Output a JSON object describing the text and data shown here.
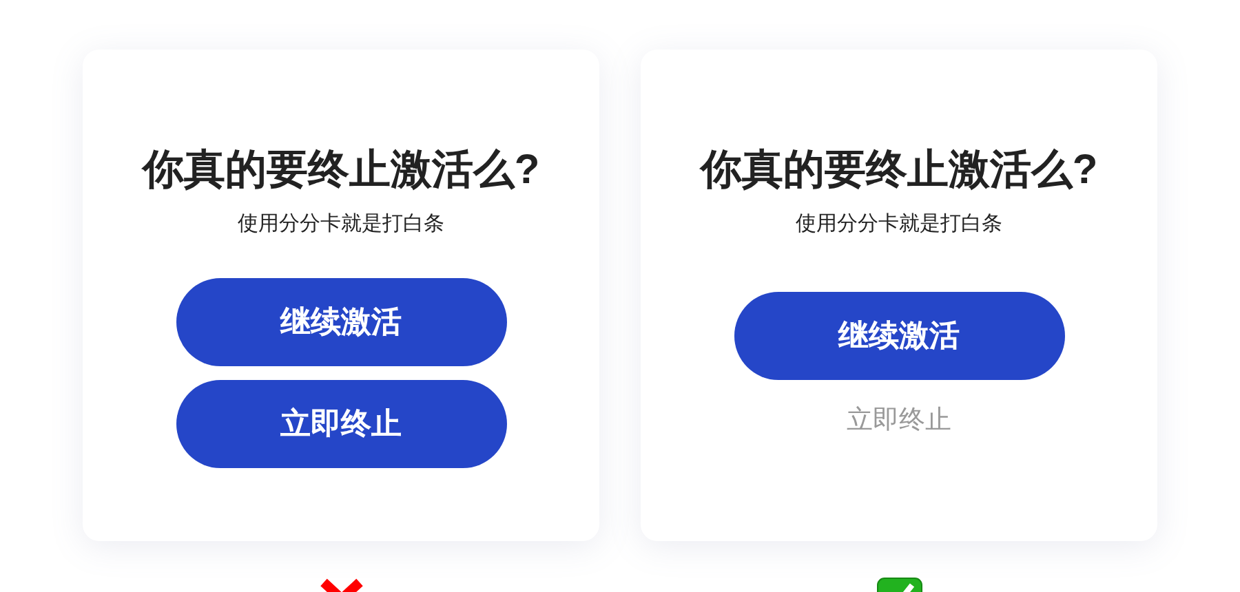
{
  "cards": [
    {
      "title": "你真的要终止激活么?",
      "subtitle": "使用分分卡就是打白条",
      "actions": [
        {
          "kind": "button",
          "label": "继续激活"
        },
        {
          "kind": "button",
          "label": "立即终止"
        }
      ],
      "mark": {
        "kind": "cross"
      }
    },
    {
      "title": "你真的要终止激活么?",
      "subtitle": "使用分分卡就是打白条",
      "actions": [
        {
          "kind": "button",
          "label": "继续激活"
        },
        {
          "kind": "link",
          "label": "立即终止"
        }
      ],
      "mark": {
        "kind": "check"
      }
    }
  ]
}
